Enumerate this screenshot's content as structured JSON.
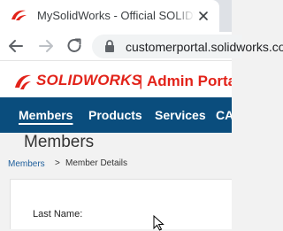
{
  "browser": {
    "tab": {
      "title": "MySolidWorks - Official SOLIDWORKS Community",
      "favicon": "solidworks-ds-icon"
    },
    "address_bar": {
      "url": "customerportal.solidworks.com",
      "lock": "lock-icon"
    }
  },
  "portal": {
    "brand": {
      "logo": "ds-logo",
      "name": "SOLIDWORKS",
      "separator": "|",
      "suffix": "Admin Portal",
      "color": "#e2231a"
    },
    "nav": {
      "color": "#0a4d7d",
      "items": [
        {
          "label": "Members",
          "active": true
        },
        {
          "label": "Products",
          "active": false
        },
        {
          "label": "Services",
          "active": false
        },
        {
          "label": "CA",
          "active": false
        }
      ]
    },
    "page_title": "Members",
    "breadcrumb": {
      "link": "Members",
      "separator": ">",
      "current": "Member Details"
    },
    "details": {
      "last_name_label": "Last Name:",
      "last_name_value": ""
    }
  }
}
